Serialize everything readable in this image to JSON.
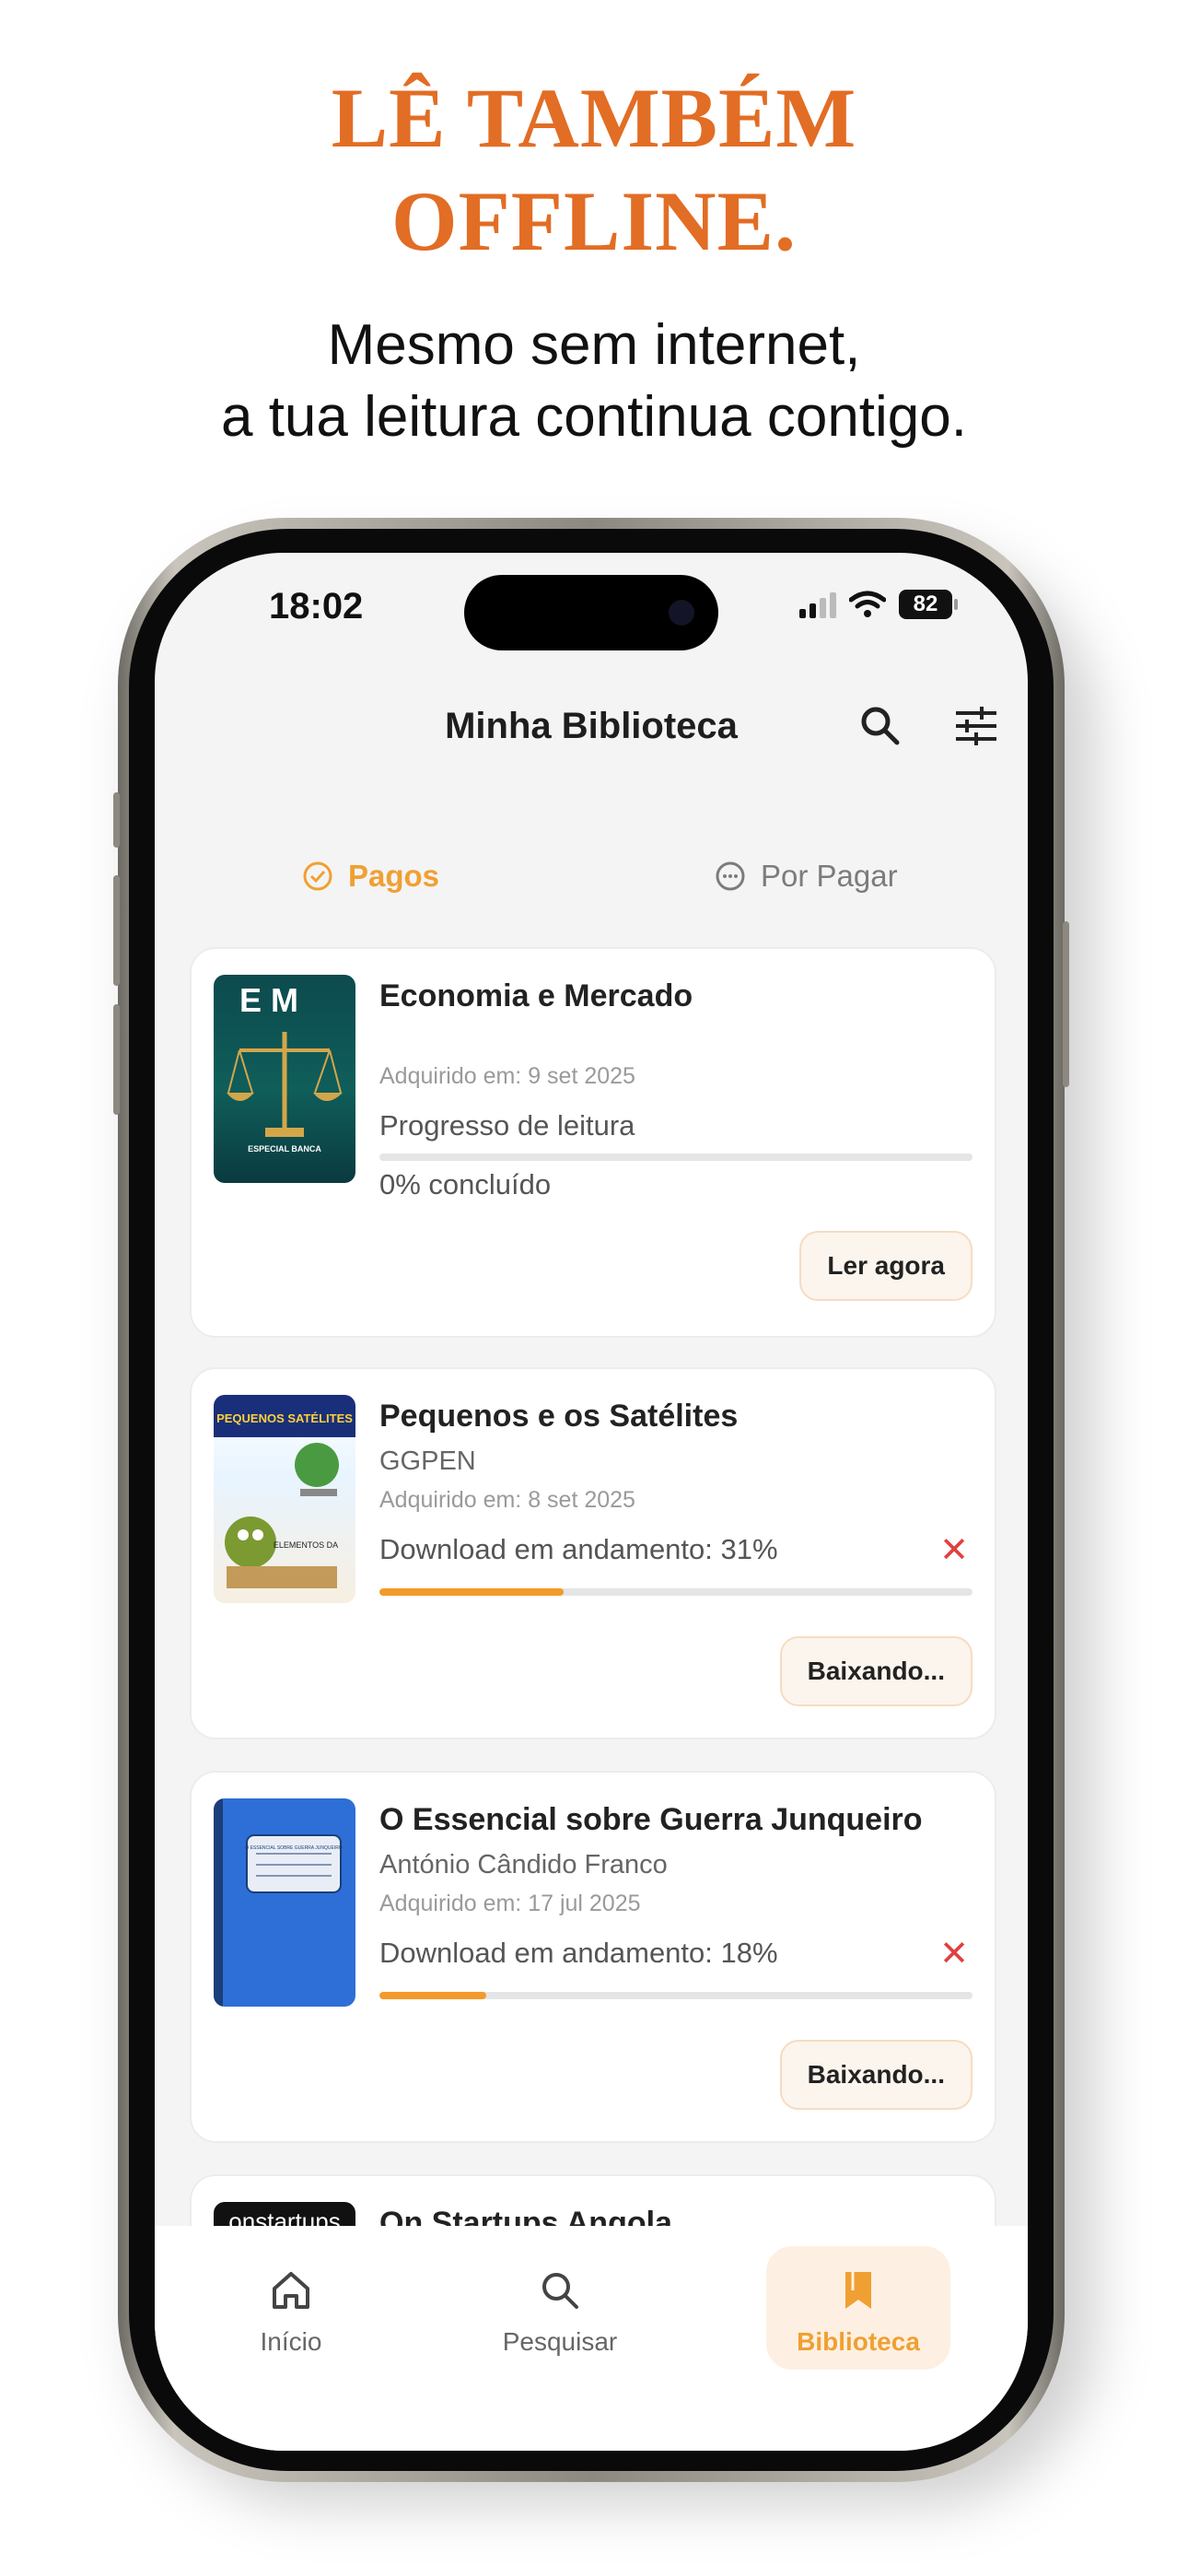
{
  "promo": {
    "headline_line1": "LÊ TAMBÉM",
    "headline_line2": "OFFLINE.",
    "sub_line1": "Mesmo sem internet,",
    "sub_line2": "a tua leitura continua contigo."
  },
  "status_bar": {
    "time": "18:02",
    "battery": "82"
  },
  "header": {
    "title": "Minha Biblioteca",
    "search_icon": "search-icon",
    "filter_icon": "sliders-icon"
  },
  "tabs": [
    {
      "label": "Pagos",
      "icon": "check-circle-icon",
      "active": true
    },
    {
      "label": "Por Pagar",
      "icon": "ellipsis-circle-icon",
      "active": false
    }
  ],
  "books": [
    {
      "title": "Economia e Mercado",
      "acquired": "Adquirido em: 9 set 2025",
      "progress_label": "Progresso de leitura",
      "progress": 0,
      "progress_text": "0% concluído",
      "action": "Ler agora"
    },
    {
      "title": "Pequenos e os Satélites",
      "author": "GGPEN",
      "acquired": "Adquirido em: 8 set 2025",
      "download_text": "Download em andamento: 31%",
      "progress": 31,
      "cancel_symbol": "✕",
      "action": "Baixando..."
    },
    {
      "title": "O Essencial sobre Guerra Junqueiro",
      "author": "António Cândido Franco",
      "acquired": "Adquirido em: 17 jul 2025",
      "download_text": "Download em andamento: 18%",
      "progress": 18,
      "cancel_symbol": "✕",
      "action": "Baixando..."
    },
    {
      "title": "On Startups Angola",
      "cover_text": "onstartups"
    }
  ],
  "covers": {
    "em_logo": "E M",
    "em_badge": "ESPECIAL BANCA",
    "pequenos_title": "PEQUENOS SATÉLITES",
    "essencial_label": "O ESSENCIAL SOBRE GUERRA JUNQUEIRO"
  },
  "bottom_nav": [
    {
      "label": "Início",
      "icon": "home-icon",
      "active": false
    },
    {
      "label": "Pesquisar",
      "icon": "search-icon",
      "active": false
    },
    {
      "label": "Biblioteca",
      "icon": "bookmark-icon",
      "active": true
    }
  ],
  "colors": {
    "accent": "#f0a032",
    "headline": "#e26d25",
    "cancel": "#e04040"
  }
}
